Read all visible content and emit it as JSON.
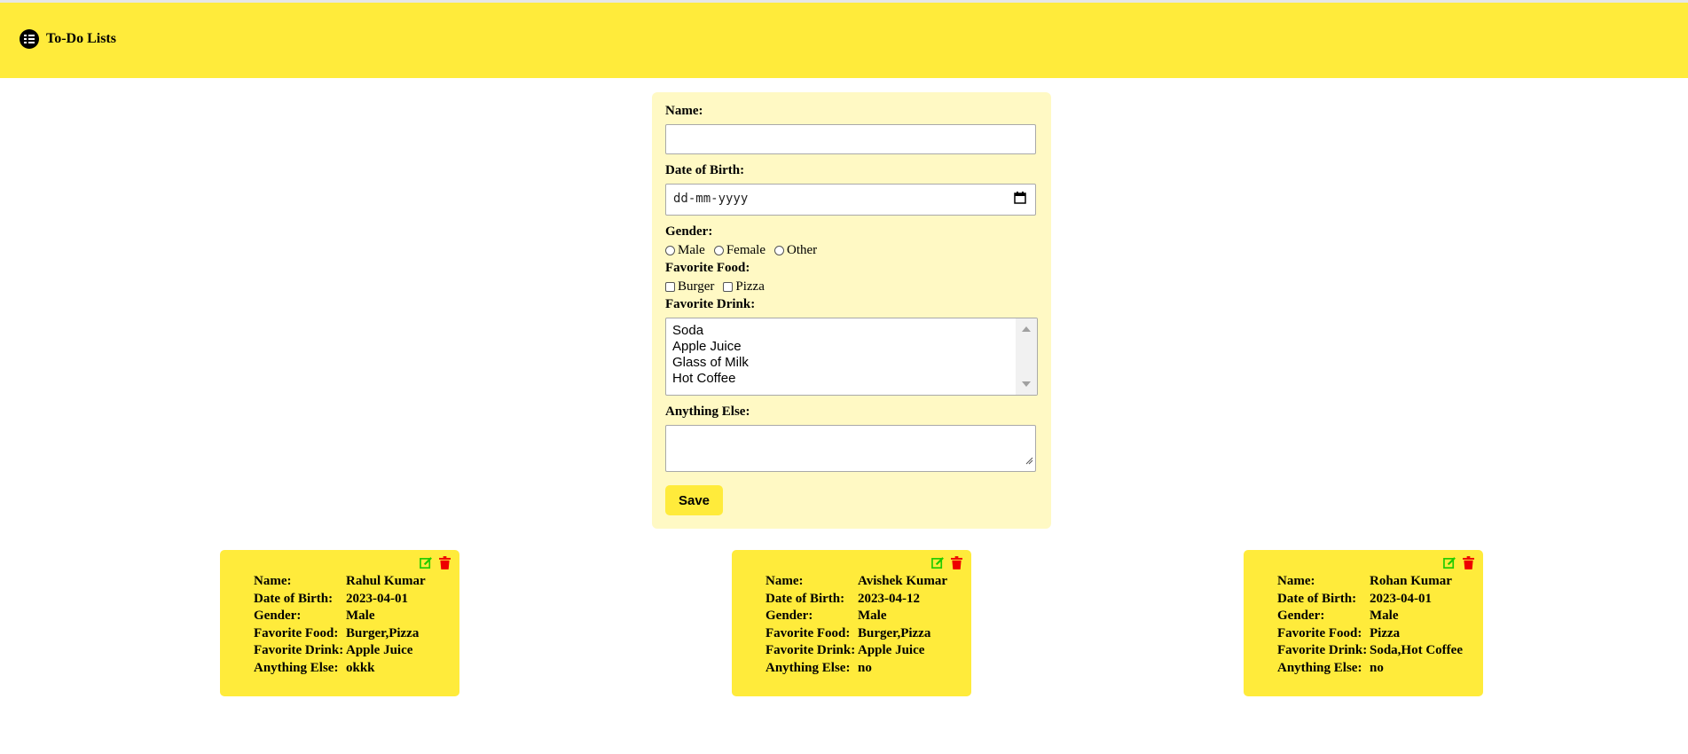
{
  "app": {
    "title": "To-Do Lists",
    "icon": "checklist-icon"
  },
  "form": {
    "name_label": "Name:",
    "name_value": "",
    "dob_label": "Date of Birth:",
    "dob_placeholder": "dd-mm-yyyy",
    "gender_label": "Gender:",
    "gender_options": [
      "Male",
      "Female",
      "Other"
    ],
    "food_label": "Favorite Food:",
    "food_options": [
      "Burger",
      "Pizza"
    ],
    "drink_label": "Favorite Drink:",
    "drink_options": [
      "Soda",
      "Apple Juice",
      "Glass of Milk",
      "Hot Coffee"
    ],
    "else_label": "Anything Else:",
    "else_value": "",
    "save_label": "Save"
  },
  "card_labels": {
    "name": "Name:",
    "dob": "Date of Birth:",
    "gender": "Gender:",
    "food": "Favorite Food:",
    "drink": "Favorite Drink:",
    "else": "Anything Else:"
  },
  "cards": [
    {
      "name": "Rahul Kumar",
      "dob": "2023-04-01",
      "gender": "Male",
      "food": "Burger,Pizza",
      "drink": "Apple Juice",
      "else": "okkk"
    },
    {
      "name": "Avishek Kumar",
      "dob": "2023-04-12",
      "gender": "Male",
      "food": "Burger,Pizza",
      "drink": "Apple Juice",
      "else": "no"
    },
    {
      "name": "Rohan Kumar",
      "dob": "2023-04-01",
      "gender": "Male",
      "food": "Pizza",
      "drink": "Soda,Hot Coffee",
      "else": "no"
    }
  ],
  "colors": {
    "header": "#ffeb3b",
    "form_bg": "#fff9c4",
    "edit_icon": "#22cc00",
    "delete_icon": "#ee0000"
  }
}
